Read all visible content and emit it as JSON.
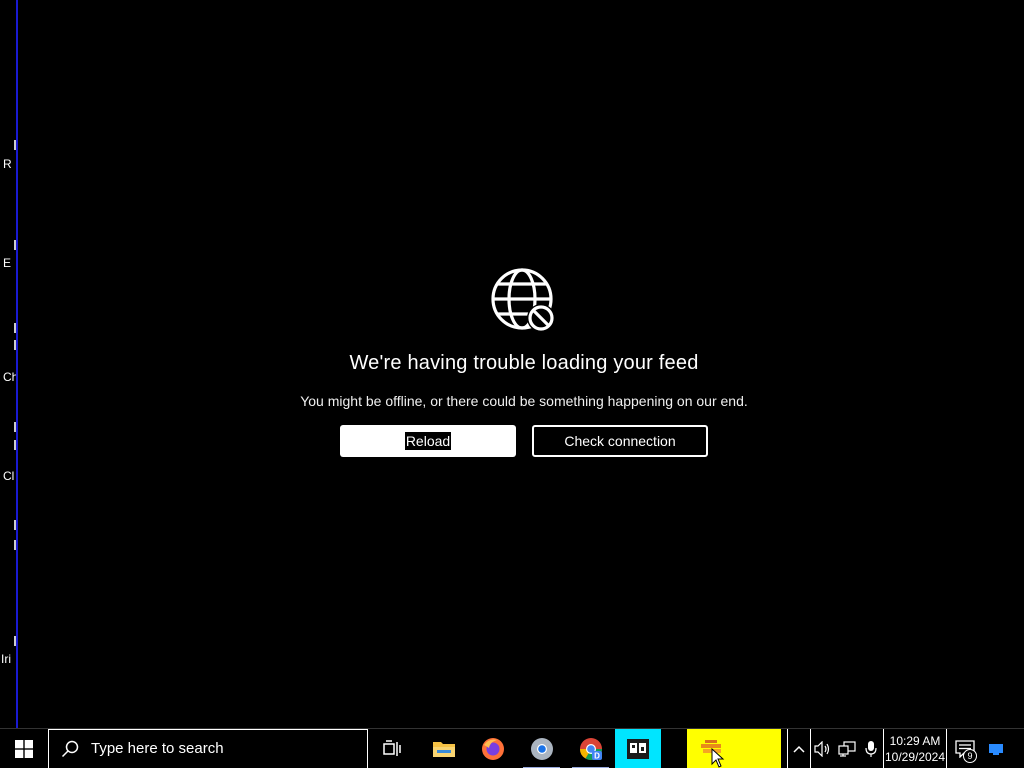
{
  "desktop": {
    "fragments": [
      "R",
      "E",
      "Ch",
      "Cl",
      "Iri"
    ]
  },
  "error": {
    "icon": "globe-blocked-icon",
    "title": "We're having trouble loading your feed",
    "subtitle": "You might be offline, or there could be something happening on our end.",
    "reload_label": "Reload",
    "check_label": "Check connection"
  },
  "taskbar": {
    "search_placeholder": "Type here to search",
    "apps": [
      "task-view-icon",
      "file-explorer-icon",
      "firefox-icon",
      "chrome-icon",
      "chrome-dev-icon",
      "app-icon-active"
    ],
    "yellow_app_label": "",
    "tray_icons": [
      "chevron-up-icon",
      "volume-icon",
      "network-icon",
      "microphone-icon"
    ],
    "time": "10:29 AM",
    "date": "10/29/2024",
    "notification_count": "9"
  },
  "colors": {
    "background": "#000000",
    "taskbar_yellow": "#ffff00",
    "active_app": "#00e5ff",
    "window_edge": "#1a1ad0"
  }
}
